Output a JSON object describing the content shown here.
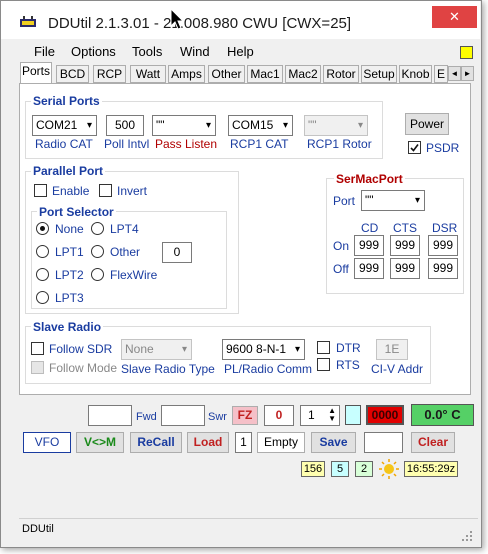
{
  "window": {
    "title": "DDUtil 2.1.3.01 - 21.008.980  CWU  [CWX=25]",
    "close_glyph": "✕"
  },
  "menu": [
    "File",
    "Options",
    "Tools",
    "Wind",
    "Help"
  ],
  "tabs": [
    "Ports",
    "BCD",
    "RCP",
    "Watt",
    "Amps",
    "Other",
    "Mac1",
    "Mac2",
    "Rotor",
    "Setup",
    "Knob",
    "E"
  ],
  "tab_scroll": {
    "left": "◄",
    "right": "►"
  },
  "serial_ports": {
    "title": "Serial Ports",
    "radio_cat_value": "COM21",
    "radio_cat_label": "Radio CAT",
    "poll_value": "500",
    "poll_label": "Poll Intvl",
    "pass_listen_value": "\"\"",
    "pass_listen_label": "Pass Listen",
    "rcp1_cat_value": "COM15",
    "rcp1_cat_label": "RCP1 CAT",
    "rcp1_rotor_value": "\"\"",
    "rcp1_rotor_label": "RCP1 Rotor"
  },
  "power_button": "Power",
  "psdr": {
    "label": "PSDR",
    "checked": true
  },
  "parallel_port": {
    "title": "Parallel Port",
    "enable_label": "Enable",
    "invert_label": "Invert",
    "selector_title": "Port Selector",
    "options": [
      "None",
      "LPT4",
      "LPT1",
      "Other",
      "LPT2",
      "FlexWire",
      "LPT3"
    ],
    "other_value": "0"
  },
  "sermacport": {
    "title": "SerMacPort",
    "port_label": "Port",
    "port_value": "\"\"",
    "columns": [
      "CD",
      "CTS",
      "DSR"
    ],
    "rows": [
      {
        "label": "On",
        "values": [
          "999",
          "999",
          "999"
        ]
      },
      {
        "label": "Off",
        "values": [
          "999",
          "999",
          "999"
        ]
      }
    ]
  },
  "slave_radio": {
    "title": "Slave Radio",
    "follow_sdr": "Follow SDR",
    "follow_mode": "Follow Mode",
    "radio_type_value": "None",
    "radio_type_label": "Slave Radio Type",
    "pl_value": "9600 8-N-1",
    "pl_label": "PL/Radio Comm",
    "dtr": "DTR",
    "rts": "RTS",
    "civ_value": "1E",
    "civ_label": "CI-V Addr"
  },
  "bottom": {
    "fwd_label": "Fwd",
    "swr_label": "Swr",
    "fz_label": "FZ",
    "counter_value": "0",
    "spinner_value": "1",
    "red_display": "0000",
    "temp_display": "0.0° C",
    "vfo": "VFO",
    "v_to_m": "V<>M",
    "recall": "ReCall",
    "load": "Load",
    "slot": "1",
    "empty": "Empty",
    "save": "Save",
    "clear": "Clear",
    "badge_1": "156",
    "badge_2": "5",
    "badge_3": "2",
    "time": "16:55:29z"
  },
  "status_text": "DDUtil",
  "colors": {
    "group_blue": "#1a3ca0",
    "pass_red": "#b00000",
    "fz_bg": "#f5c0c8",
    "red_display_bg": "#e00000",
    "temp_bg": "#55d066",
    "vm_green": "#1a8a1a",
    "recall_blue": "#1a3ca0",
    "load_red": "#c02020",
    "badge_yellow": "#ffffb0",
    "badge_cyan": "#c8ffff",
    "badge_green": "#d8ffd8"
  }
}
